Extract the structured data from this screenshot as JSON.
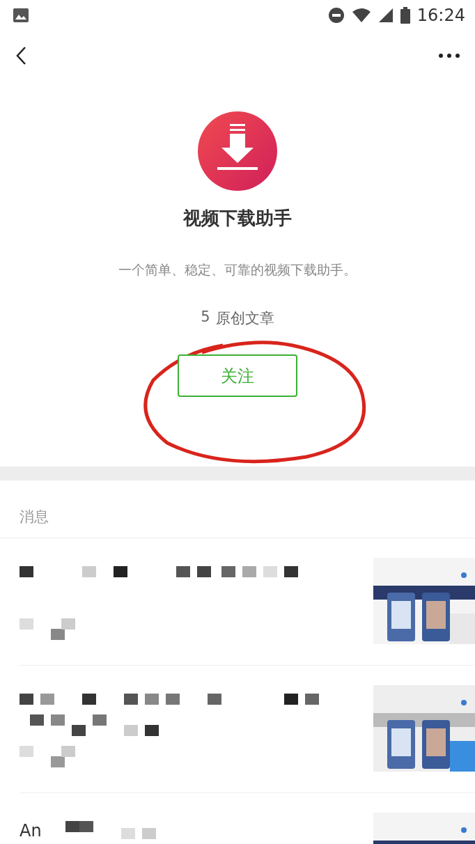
{
  "status_bar": {
    "time": "16:24"
  },
  "account": {
    "name": "视频下载助手",
    "description": "一个简单、稳定、可靠的视频下载助手。",
    "article_count": "5",
    "article_label": "原创文章",
    "follow_button": "关注"
  },
  "messages": {
    "heading": "消息",
    "items": [
      {
        "thumbnail": {
          "kind": "picture"
        }
      },
      {
        "thumbnail": {
          "kind": "picture"
        }
      },
      {
        "visible_text": "An",
        "thumbnail": {
          "kind": "picture"
        }
      }
    ]
  }
}
